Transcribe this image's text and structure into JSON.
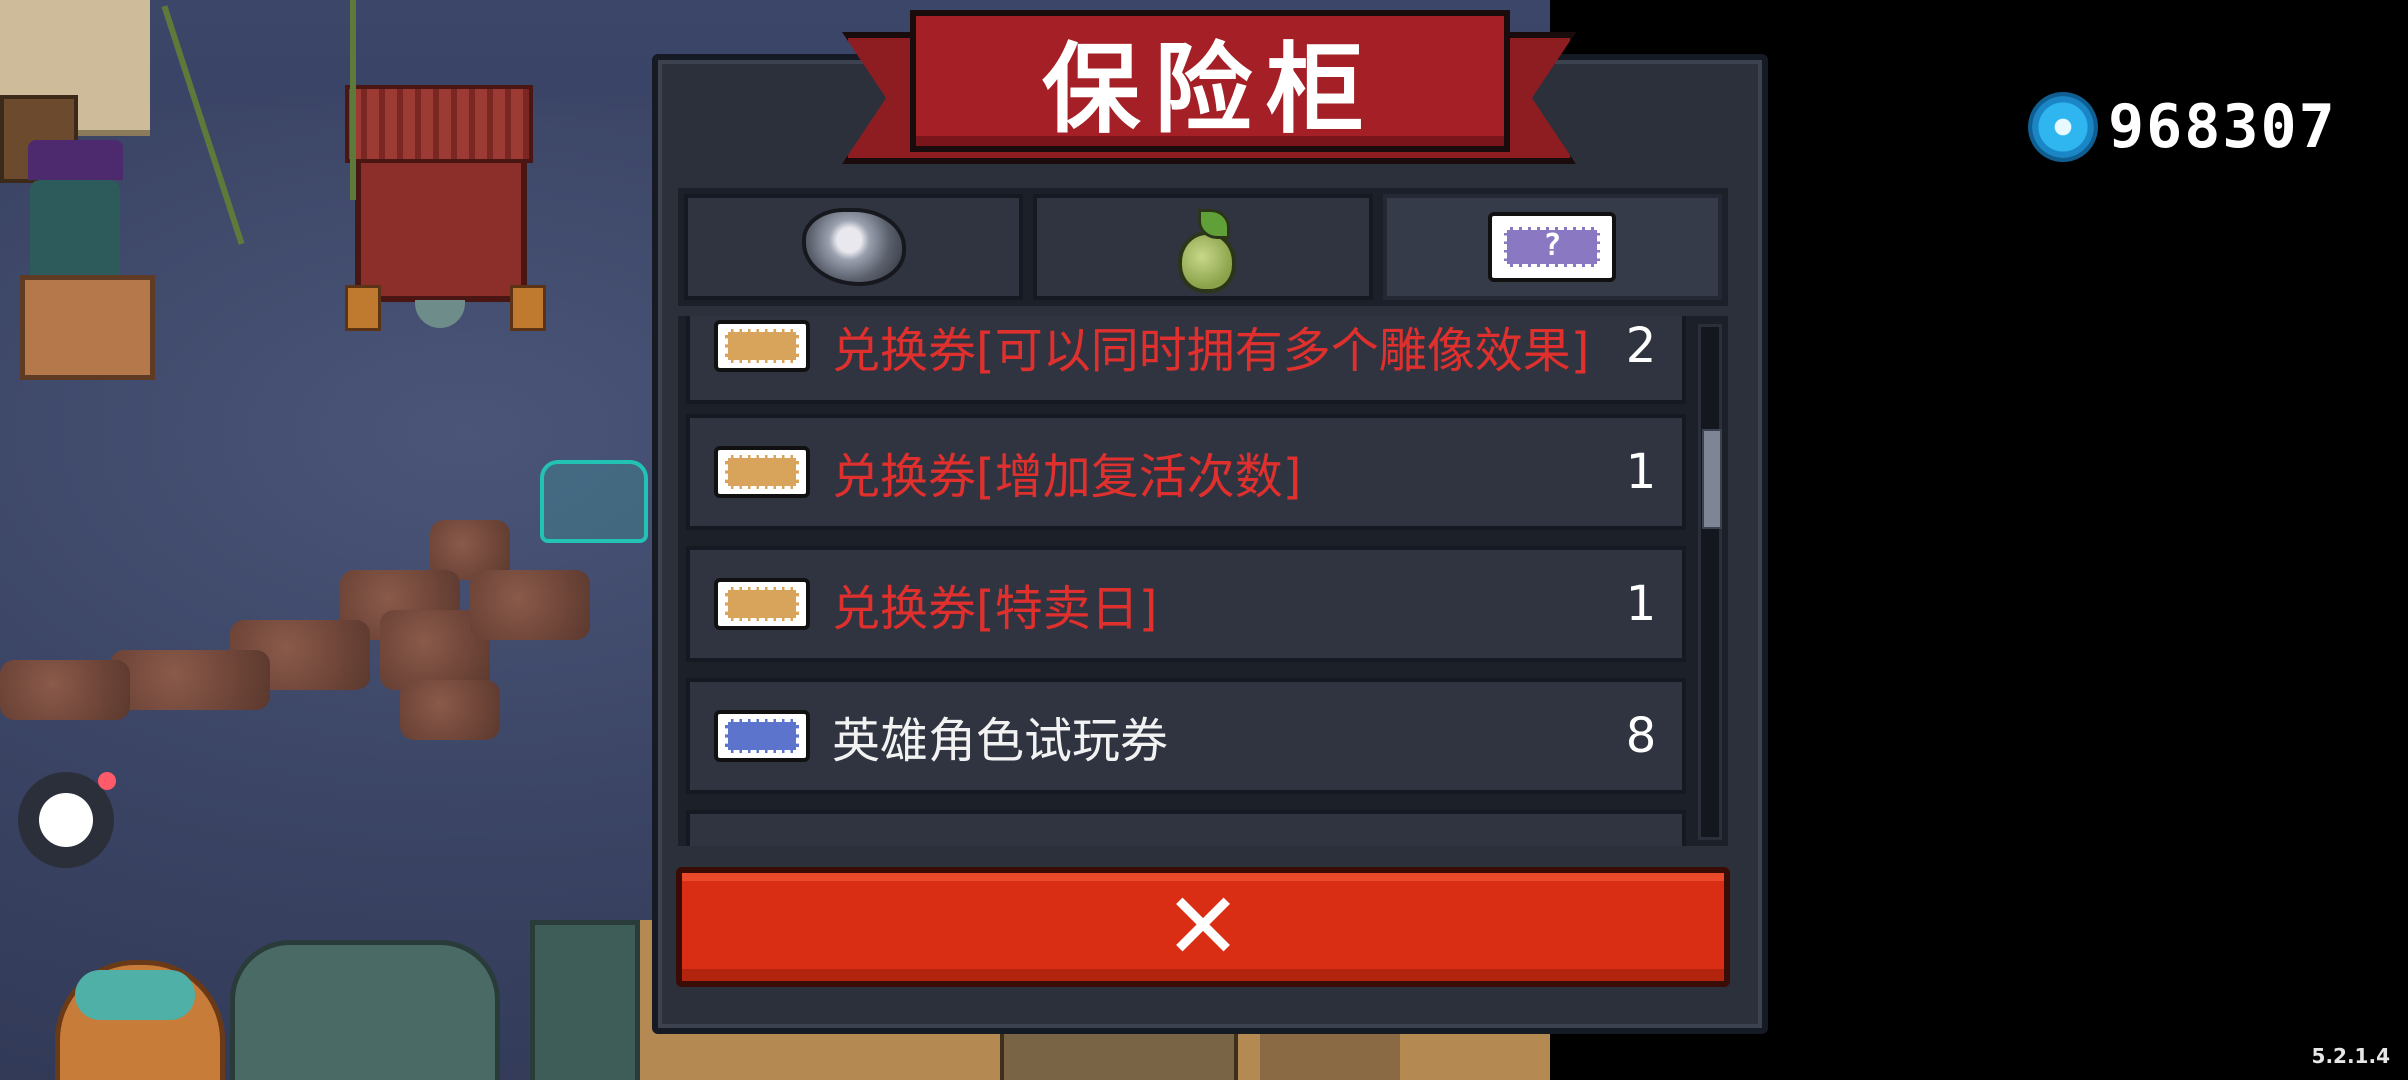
{
  "dialog": {
    "title": "保险柜",
    "tabs": [
      {
        "icon": "ore-icon",
        "active": false
      },
      {
        "icon": "seed-icon",
        "active": false
      },
      {
        "icon": "ticket-icon",
        "active": true,
        "glyph": "?"
      }
    ],
    "items": [
      {
        "name": "兑换券[可以同时拥有多个雕像效果]",
        "count": "2",
        "ticket_color": "#d8a45c",
        "name_color": "red"
      },
      {
        "name": "兑换券[增加复活次数]",
        "count": "1",
        "ticket_color": "#d8a45c",
        "name_color": "red"
      },
      {
        "name": "兑换券[特卖日]",
        "count": "1",
        "ticket_color": "#d8a45c",
        "name_color": "red"
      },
      {
        "name": "英雄角色试玩券",
        "count": "8",
        "ticket_color": "#5c74cc",
        "name_color": "white"
      }
    ],
    "close_label": "✕"
  },
  "currency": {
    "icon": "gem-icon",
    "value": "968307"
  },
  "version": "5.2.1.4",
  "colors": {
    "accent_red": "#d92e13",
    "banner_red": "#a41f26",
    "item_red_text": "#e0302e",
    "panel": "#2b303b"
  }
}
